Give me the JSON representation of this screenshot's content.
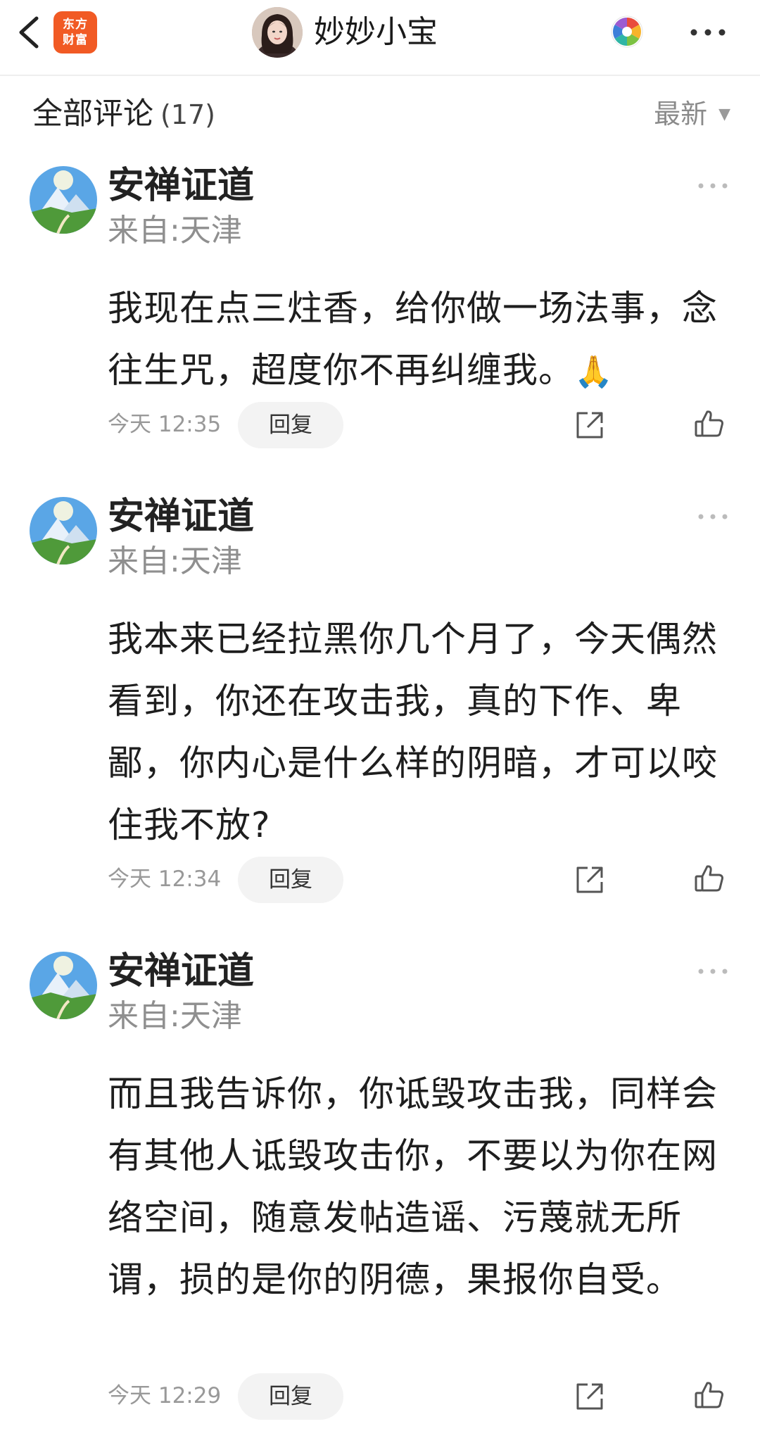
{
  "topbar": {
    "logo_line1": "东方",
    "logo_line2": "财富",
    "author_name": "妙妙小宝",
    "icons": [
      "back-icon",
      "color-wheel-icon",
      "more-icon"
    ]
  },
  "comments_header": {
    "title": "全部评论",
    "count": "(17)",
    "sort_label": "最新",
    "sort_icon": "caret-down-icon"
  },
  "reply_label": "回复",
  "comments": [
    {
      "name": "安禅证道",
      "location": "来自:天津",
      "text": "我现在点三炷香，给你做一场法事，念往生咒，超度你不再纠缠我。",
      "emoji": "🙏",
      "time": "今天 12:35"
    },
    {
      "name": "安禅证道",
      "location": "来自:天津",
      "text": "我本来已经拉黑你几个月了，今天偶然看到，你还在攻击我，真的下作、卑鄙，你内心是什么样的阴暗，才可以咬住我不放?",
      "time": "今天 12:34"
    },
    {
      "name": "安禅证道",
      "location": "来自:天津",
      "text": "而且我告诉你，你诋毁攻击我，同样会有其他人诋毁攻击你，不要以为你在网络空间，随意发帖造谣、污蔑就无所谓，损的是你的阴德，果报你自受。",
      "time": "今天 12:29"
    }
  ],
  "colors": {
    "logo_bg": "#f15a24",
    "reply_bg": "#f3f3f3",
    "meta_text": "#999999"
  }
}
